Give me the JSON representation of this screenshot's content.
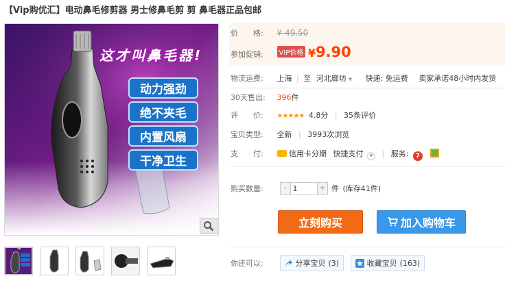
{
  "title": "【Vip购优汇】电动鼻毛修剪器 男士修鼻毛剪 剪 鼻毛器正品包邮",
  "main_image": {
    "banner_text": "这才叫鼻毛器!",
    "features": [
      "动力强劲",
      "绝不夹毛",
      "内置风扇",
      "干净卫生"
    ]
  },
  "price": {
    "label": "价　　格:",
    "original": "¥ 49.50",
    "promo_label": "参加促销:",
    "vip_badge": "VIP价格",
    "currency": "¥",
    "promo_value": "9.90"
  },
  "shipping": {
    "label": "物流运费:",
    "from": "上海",
    "to_label": "至",
    "to": "河北廊坊",
    "express": "快递: 免运费",
    "promise": "卖家承诺48小时内发货"
  },
  "sales": {
    "label": "30天售出:",
    "count": "396",
    "unit": "件"
  },
  "rating": {
    "label": "评　　价:",
    "stars": "★★★★★",
    "score": "4.8分",
    "reviews": "35条评价"
  },
  "item_type": {
    "label": "宝贝类型:",
    "value": "全新",
    "views": "3993次浏览"
  },
  "payment": {
    "label": "支　　付:",
    "credit": "信用卡分期",
    "quick": "快捷支付",
    "service_label": "服务:"
  },
  "quantity": {
    "label": "购买数量:",
    "minus": "-",
    "value": "1",
    "plus": "+",
    "unit": "件",
    "stock": "(库存41件)"
  },
  "actions": {
    "buy": "立刻购买",
    "cart": "加入购物车"
  },
  "more": {
    "label": "你还可以:",
    "share": "分享宝贝",
    "share_count": "(3)",
    "fav": "收藏宝贝",
    "fav_count": "(163)"
  },
  "colors": {
    "price_orange": "#ff4400",
    "buy_orange": "#f16b16",
    "cart_blue": "#3a98e8",
    "star_orange": "#ff9a00",
    "feature_blue": "#1a73c9"
  }
}
